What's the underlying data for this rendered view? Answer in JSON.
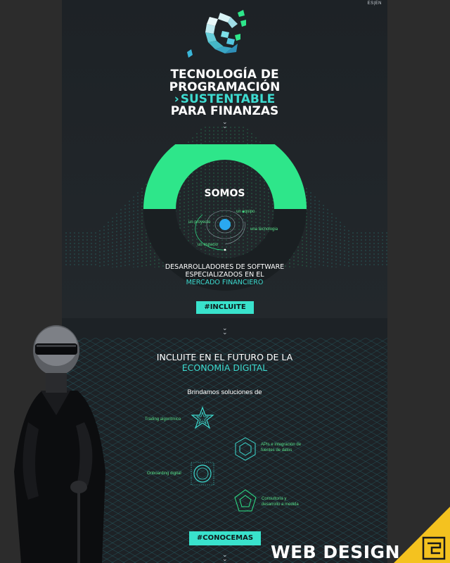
{
  "nav": {
    "lang": "ES|EN"
  },
  "hero": {
    "line1": "TECNOLOGÍA DE",
    "line2": "PROGRAMACIÓN",
    "line3_chevron": "›",
    "line3": "SUSTENTABLE",
    "line4": "PARA FINANZAS"
  },
  "somos": {
    "title": "SOMOS",
    "orbit_labels": [
      "un proyecto",
      "un equipo",
      "una tecnologia",
      "un espacio"
    ],
    "desc_line1": "DESARROLLADORES DE SOFTWARE",
    "desc_line2": "ESPECIALIZADOS EN EL",
    "desc_line3": "MERCADO FINANCIERO",
    "button": "#INCLUITE"
  },
  "incluite": {
    "title_line1": "INCLUITE EN EL FUTURO DE LA",
    "title_line2": "ECONOMÍA DIGITAL",
    "subtitle": "Brindamos soluciones de",
    "services": [
      {
        "label": "Trading algorítmico"
      },
      {
        "label_l1": "APIs e integración de",
        "label_l2": "fuentes de datos"
      },
      {
        "label": "Onboarding digital"
      },
      {
        "label_l1": "Consultoría y",
        "label_l2": "desarrollo a medida"
      }
    ],
    "button": "#CONOCEMAS"
  },
  "overlay": {
    "text": "WEB DESIGN"
  },
  "colors": {
    "accent": "#3ddbd0",
    "green": "#2ee68a",
    "bg": "#1f2428"
  }
}
